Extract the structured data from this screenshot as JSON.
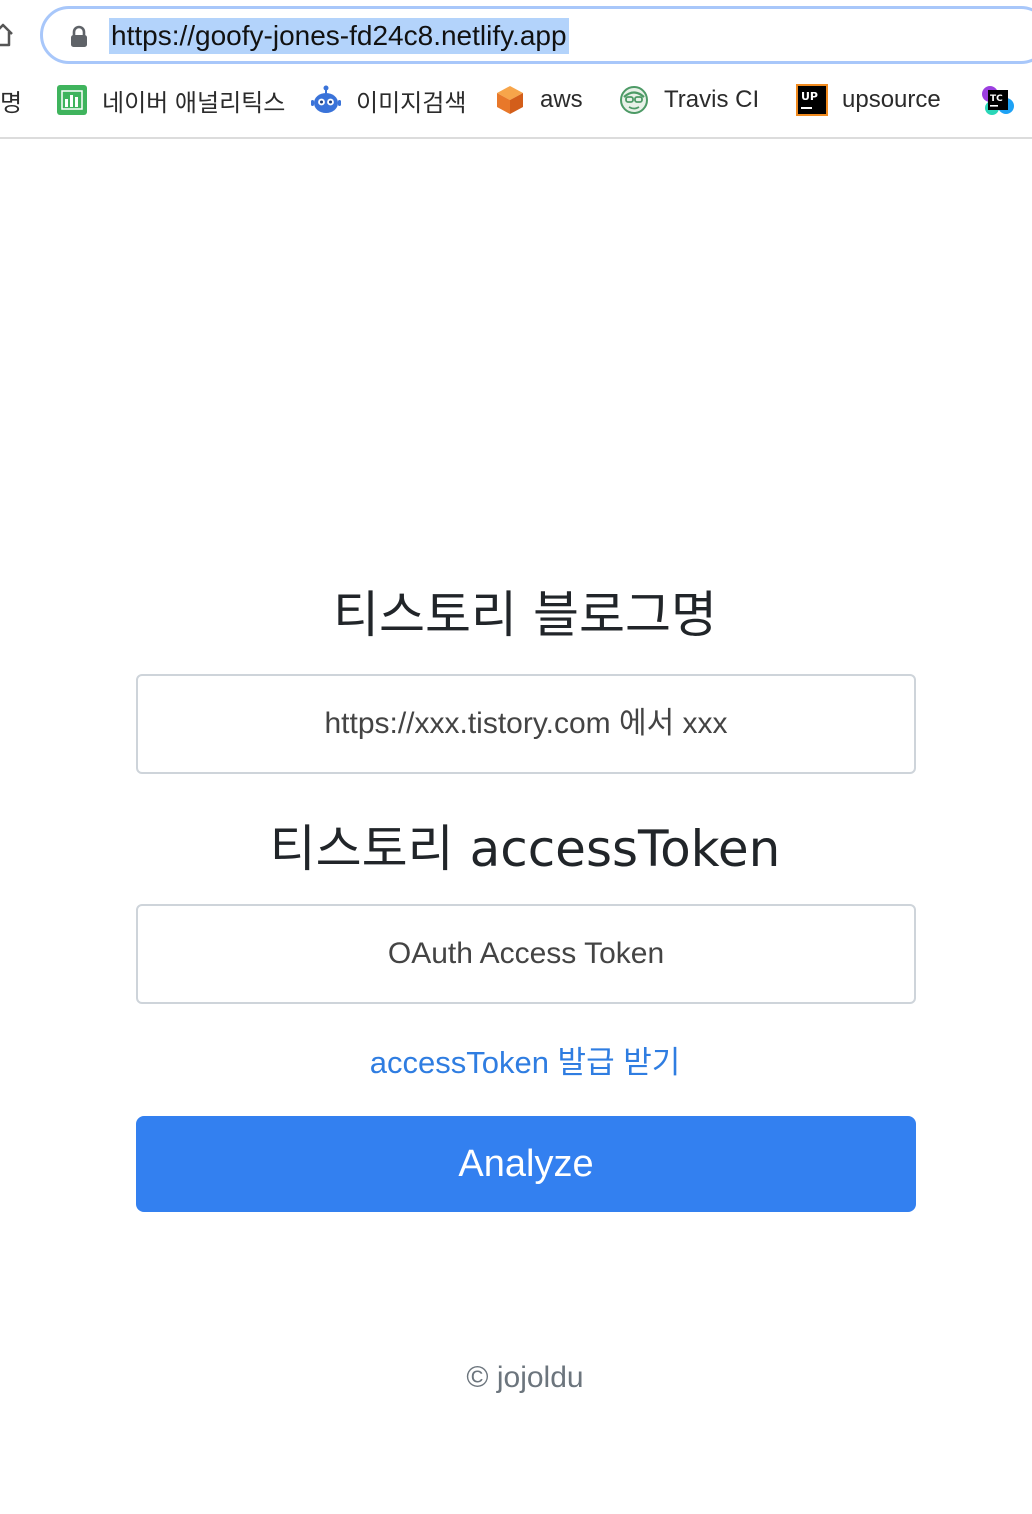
{
  "browser": {
    "url": "https://goofy-jones-fd24c8.netlify.app",
    "bookmarks": [
      {
        "label": "명",
        "icon": "truncated-bookmark"
      },
      {
        "label": "네이버 애널리틱스",
        "icon": "analytics-chart-icon"
      },
      {
        "label": "이미지검색",
        "icon": "robot-icon"
      },
      {
        "label": "aws",
        "icon": "aws-cube-icon"
      },
      {
        "label": "Travis CI",
        "icon": "travis-mascot-icon"
      },
      {
        "label": "upsource",
        "icon": "upsource-icon"
      },
      {
        "label": "",
        "icon": "teamcity-icon"
      }
    ]
  },
  "form": {
    "blog_title": "티스토리 블로그명",
    "blog_placeholder": "https://xxx.tistory.com 에서 xxx",
    "token_title": "티스토리 accessToken",
    "token_placeholder": "OAuth Access Token",
    "issue_link": "accessToken 발급 받기",
    "submit_label": "Analyze"
  },
  "footer": {
    "copyright": "© jojoldu"
  },
  "colors": {
    "primary": "#3380f0",
    "link": "#2f7de1",
    "url_highlight": "#b3d3fb",
    "address_focus": "#a8c7fa"
  }
}
